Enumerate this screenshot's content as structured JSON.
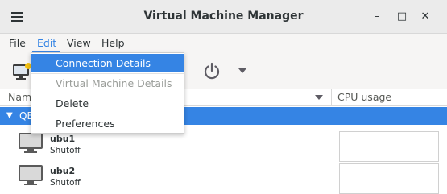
{
  "window": {
    "title": "Virtual Machine Manager",
    "minimize_glyph": "–",
    "maximize_glyph": "□",
    "close_glyph": "✕"
  },
  "menubar": {
    "file": "File",
    "edit": "Edit",
    "view": "View",
    "help": "Help"
  },
  "columns": {
    "name": "Name",
    "cpu": "CPU usage"
  },
  "connection": {
    "name": "QEMU/KVM"
  },
  "vms": [
    {
      "name": "ubu1",
      "state": "Shutoff"
    },
    {
      "name": "ubu2",
      "state": "Shutoff"
    }
  ],
  "edit_menu": {
    "items": [
      {
        "label": "Connection Details",
        "state": "highlighted"
      },
      {
        "label": "Virtual Machine Details",
        "state": "disabled"
      },
      {
        "label": "Delete",
        "state": "normal"
      },
      {
        "label": "Preferences",
        "state": "normal"
      }
    ]
  },
  "colors": {
    "accent": "#3584e4",
    "titlebar": "#ebebeb",
    "menubar": "#f6f5f4",
    "disabled_text": "#9a9d99"
  },
  "icons": {
    "menu": "hamburger-icon",
    "new_vm": "new-vm-icon",
    "power": "power-icon",
    "dropdown": "chevron-down-icon",
    "vm": "monitor-icon"
  }
}
